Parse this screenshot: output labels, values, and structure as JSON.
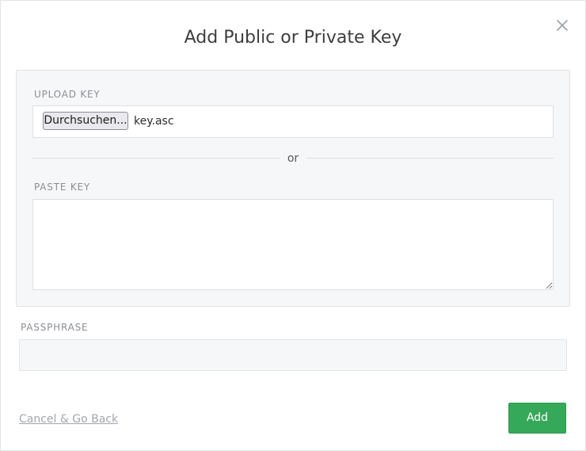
{
  "dialog": {
    "title": "Add Public or Private Key",
    "close_icon": "close-icon"
  },
  "upload": {
    "label": "UPLOAD KEY",
    "browse_button": "Durchsuchen...",
    "file_name": "key.asc"
  },
  "divider": {
    "text": "or"
  },
  "paste": {
    "label": "PASTE KEY",
    "value": ""
  },
  "passphrase": {
    "label": "PASSPHRASE",
    "value": ""
  },
  "footer": {
    "cancel_label": "Cancel & Go Back",
    "add_label": "Add"
  },
  "colors": {
    "primary_button": "#36a85a",
    "panel_background": "#f6f7f8"
  }
}
